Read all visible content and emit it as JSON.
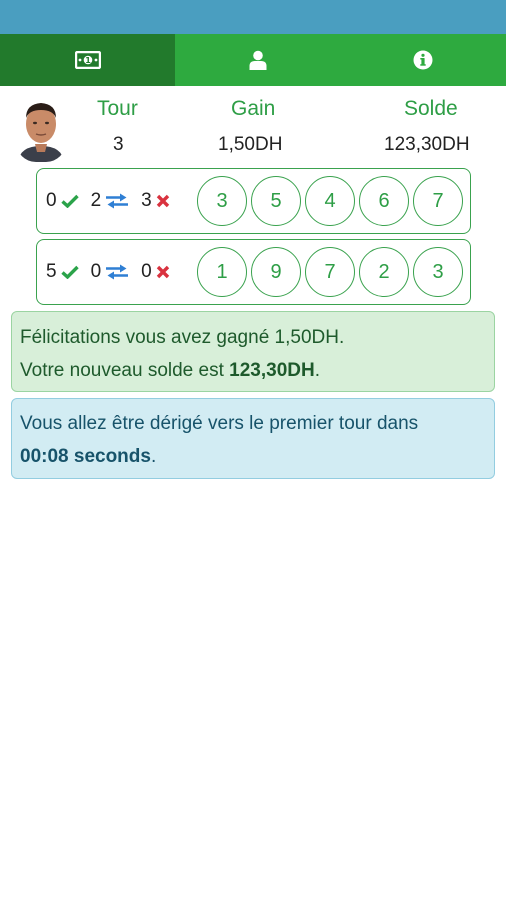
{
  "colors": {
    "status_bar": "#4a9ec0",
    "tab_bar": "#2eaa3f",
    "tab_active": "#227a2c",
    "accent_green": "#2e9e46",
    "check": "#2ba34a",
    "swap": "#2f7fd4",
    "cross": "#d9323f"
  },
  "tabs": [
    {
      "icon": "money-icon",
      "active": true
    },
    {
      "icon": "user-icon",
      "active": false
    },
    {
      "icon": "info-icon",
      "active": false
    }
  ],
  "header": {
    "tour_label": "Tour",
    "gain_label": "Gain",
    "solde_label": "Solde",
    "tour_value": "3",
    "gain_value": "1,50DH",
    "solde_value": "123,30DH"
  },
  "rows": [
    {
      "correct": "0",
      "misplaced": "2",
      "wrong": "3",
      "balls": [
        "3",
        "5",
        "4",
        "6",
        "7"
      ]
    },
    {
      "correct": "5",
      "misplaced": "0",
      "wrong": "0",
      "balls": [
        "1",
        "9",
        "7",
        "2",
        "3"
      ]
    }
  ],
  "success_alert": {
    "line1": "Félicitations vous avez gagné 1,50DH.",
    "line2_prefix": "Votre nouveau solde est ",
    "line2_amount": "123,30DH",
    "line2_suffix": "."
  },
  "info_alert": {
    "line1": "Vous allez être dérigé vers le premier tour dans",
    "countdown": "00:08 seconds",
    "suffix": "."
  }
}
